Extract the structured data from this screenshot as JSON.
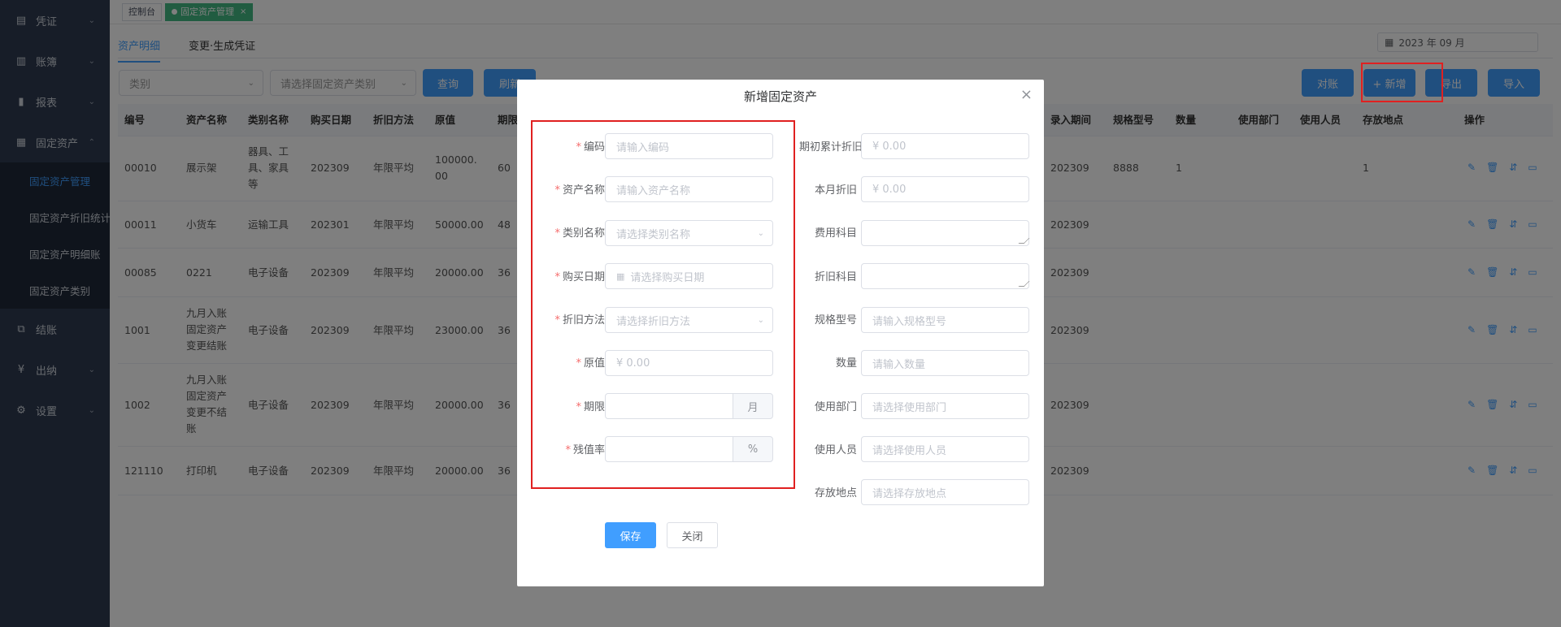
{
  "sidebar": {
    "menus": [
      {
        "label": "凭证",
        "icon": "document-icon"
      },
      {
        "label": "账簿",
        "icon": "book-icon"
      },
      {
        "label": "报表",
        "icon": "bar-chart-icon"
      },
      {
        "label": "固定资产",
        "icon": "grid-icon"
      }
    ],
    "submenus": [
      "固定资产管理",
      "固定资产折旧统计",
      "固定资产明细账",
      "固定资产类别"
    ],
    "menus_after": [
      {
        "label": "结账",
        "icon": "book-open-icon"
      },
      {
        "label": "出纳",
        "icon": "yen-icon"
      },
      {
        "label": "设置",
        "icon": "gear-icon"
      }
    ]
  },
  "tags": {
    "dashboard": "控制台",
    "current": "固定资产管理",
    "close": "×"
  },
  "tabs": [
    "资产明细",
    "变更·生成凭证"
  ],
  "period": "2023 年 09 月",
  "filters": {
    "category": "类别",
    "asset_category_placeholder": "请选择固定资产类别"
  },
  "toolbar": {
    "query": "查询",
    "refresh": "刷新",
    "reconcile": "对账",
    "add": "+ 新增",
    "export": "导出",
    "import": "导入"
  },
  "table": {
    "headers": [
      "编号",
      "资产名称",
      "类别名称",
      "购买日期",
      "折旧方法",
      "原值",
      "期限",
      "录入期间",
      "规格型号",
      "数量",
      "使用部门",
      "使用人员",
      "存放地点",
      "操作"
    ],
    "rows": [
      {
        "code": "00010",
        "name": "展示架",
        "category": "器具、工具、家具等",
        "date": "202309",
        "method": "年限平均",
        "value": "100000.00",
        "term": "60",
        "period": "202309",
        "spec": "8888",
        "qty": "1",
        "location": "1"
      },
      {
        "code": "00011",
        "name": "小货车",
        "category": "运输工具",
        "date": "202301",
        "method": "年限平均",
        "value": "50000.00",
        "term": "48",
        "period": "202309",
        "spec": "",
        "qty": "",
        "location": ""
      },
      {
        "code": "00085",
        "name": "0221",
        "category": "电子设备",
        "date": "202309",
        "method": "年限平均",
        "value": "20000.00",
        "term": "36",
        "period": "202309",
        "spec": "",
        "qty": "",
        "location": ""
      },
      {
        "code": "1001",
        "name": "九月入账固定资产变更结账",
        "category": "电子设备",
        "date": "202309",
        "method": "年限平均",
        "value": "23000.00",
        "term": "36",
        "period": "202309",
        "spec": "",
        "qty": "",
        "location": ""
      },
      {
        "code": "1002",
        "name": "九月入账固定资产变更不结账",
        "category": "电子设备",
        "date": "202309",
        "method": "年限平均",
        "value": "20000.00",
        "term": "36",
        "period": "202309",
        "spec": "",
        "qty": "",
        "location": ""
      },
      {
        "code": "121110",
        "name": "打印机",
        "category": "电子设备",
        "date": "202309",
        "method": "年限平均",
        "value": "20000.00",
        "term": "36",
        "period": "202309",
        "spec": "",
        "qty": "",
        "location": ""
      }
    ]
  },
  "dialog": {
    "title": "新增固定资产",
    "close": "×",
    "left_fields": [
      {
        "label": "编码",
        "placeholder": "请输入编码",
        "required": true
      },
      {
        "label": "资产名称",
        "placeholder": "请输入资产名称",
        "required": true
      },
      {
        "label": "类别名称",
        "placeholder": "请选择类别名称",
        "required": true
      },
      {
        "label": "购买日期",
        "placeholder": "请选择购买日期",
        "required": true
      },
      {
        "label": "折旧方法",
        "placeholder": "请选择折旧方法",
        "required": true
      },
      {
        "label": "原值",
        "placeholder": "¥ 0.00",
        "required": true
      },
      {
        "label": "期限",
        "placeholder": "",
        "append": "月",
        "required": true
      },
      {
        "label": "残值率",
        "placeholder": "",
        "append": "%",
        "required": true
      }
    ],
    "right_fields": [
      {
        "label": "期初累计折旧",
        "placeholder": "¥ 0.00"
      },
      {
        "label": "本月折旧",
        "placeholder": "¥ 0.00"
      },
      {
        "label": "费用科目",
        "placeholder": ""
      },
      {
        "label": "折旧科目",
        "placeholder": ""
      },
      {
        "label": "规格型号",
        "placeholder": "请输入规格型号"
      },
      {
        "label": "数量",
        "placeholder": "请输入数量"
      },
      {
        "label": "使用部门",
        "placeholder": "请选择使用部门"
      },
      {
        "label": "使用人员",
        "placeholder": "请选择使用人员"
      },
      {
        "label": "存放地点",
        "placeholder": "请选择存放地点"
      }
    ],
    "save": "保存",
    "cancel": "关闭"
  },
  "colors": {
    "primary": "#409eff",
    "sidebar": "#2e3a50",
    "highlight": "#e02020",
    "tag_active": "#42b983"
  }
}
